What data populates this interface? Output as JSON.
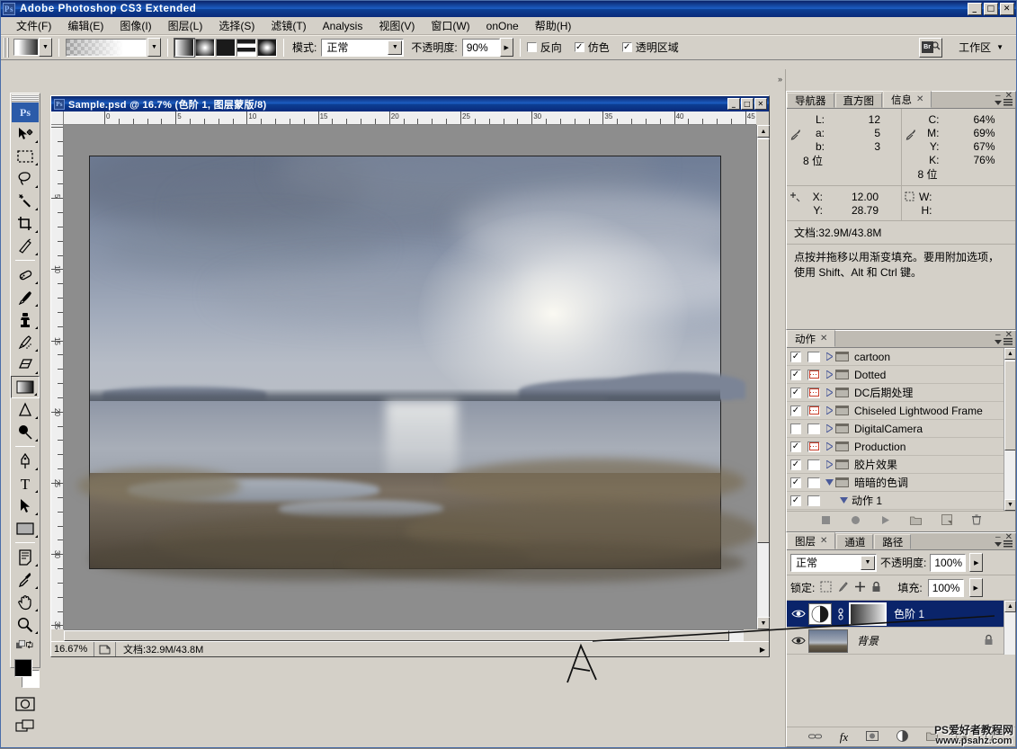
{
  "app": {
    "title": "Adobe Photoshop CS3 Extended",
    "logo": "Ps",
    "win_min": "_",
    "win_max": "□",
    "win_close": "✕"
  },
  "menubar": {
    "items": [
      {
        "label": "文件(F)"
      },
      {
        "label": "编辑(E)"
      },
      {
        "label": "图像(I)"
      },
      {
        "label": "图层(L)"
      },
      {
        "label": "选择(S)"
      },
      {
        "label": "滤镜(T)"
      },
      {
        "label": "Analysis"
      },
      {
        "label": "视图(V)"
      },
      {
        "label": "窗口(W)"
      },
      {
        "label": "onOne"
      },
      {
        "label": "帮助(H)"
      }
    ]
  },
  "options": {
    "mode_label": "模式:",
    "mode_value": "正常",
    "opacity_label": "不透明度:",
    "opacity_value": "90%",
    "reverse_label": "反向",
    "reverse_checked": false,
    "dither_label": "仿色",
    "dither_checked": true,
    "transparency_label": "透明区域",
    "transparency_checked": true,
    "bridge_badge": "Br",
    "workspace_label": "工作区",
    "gradient_types": [
      "linear-gradient-icon",
      "radial-gradient-icon",
      "angle-gradient-icon",
      "reflected-gradient-icon",
      "diamond-gradient-icon"
    ],
    "selected_gradient_type": 0
  },
  "toolbox": {
    "logo": "Ps",
    "tools": [
      {
        "name": "move-tool",
        "selected": false
      },
      {
        "name": "marquee-tool",
        "selected": false
      },
      {
        "name": "lasso-tool",
        "selected": false
      },
      {
        "name": "magic-wand-tool",
        "selected": false
      },
      {
        "name": "crop-tool",
        "selected": false
      },
      {
        "name": "slice-tool",
        "selected": false
      },
      {
        "name": "healing-brush-tool",
        "selected": false
      },
      {
        "name": "brush-tool",
        "selected": false
      },
      {
        "name": "clone-stamp-tool",
        "selected": false
      },
      {
        "name": "history-brush-tool",
        "selected": false
      },
      {
        "name": "eraser-tool",
        "selected": false
      },
      {
        "name": "gradient-tool",
        "selected": true
      },
      {
        "name": "blur-tool",
        "selected": false
      },
      {
        "name": "dodge-tool",
        "selected": false
      },
      {
        "name": "pen-tool",
        "selected": false
      },
      {
        "name": "type-tool",
        "selected": false
      },
      {
        "name": "path-selection-tool",
        "selected": false
      },
      {
        "name": "rectangle-tool",
        "selected": false
      },
      {
        "name": "notes-tool",
        "selected": false
      },
      {
        "name": "eyedropper-tool",
        "selected": false
      },
      {
        "name": "hand-tool",
        "selected": false
      },
      {
        "name": "zoom-tool",
        "selected": false
      }
    ],
    "foreground_color": "#000000",
    "background_color": "#ffffff"
  },
  "document": {
    "title": "Sample.psd @ 16.7% (色阶 1, 图层蒙版/8)",
    "logo": "Ps",
    "min": "_",
    "max": "□",
    "close": "✕",
    "zoom": "16.67%",
    "doc_size": "文档:32.9M/43.8M",
    "ruler_h_labels": [
      "0",
      "5",
      "10",
      "15",
      "20",
      "25",
      "30",
      "35",
      "40",
      "45"
    ],
    "ruler_v_labels": [
      "5",
      "10",
      "15",
      "20",
      "25",
      "30",
      "35"
    ]
  },
  "info_panel": {
    "tabs": [
      {
        "label": "导航器",
        "active": false
      },
      {
        "label": "直方图",
        "active": false
      },
      {
        "label": "信息",
        "active": true,
        "closable": true
      }
    ],
    "lab": [
      {
        "key": "L:",
        "value": "12"
      },
      {
        "key": "a:",
        "value": "5"
      },
      {
        "key": "b:",
        "value": "3"
      }
    ],
    "lab_bits": "8 位",
    "cmyk": [
      {
        "key": "C:",
        "value": "64%"
      },
      {
        "key": "M:",
        "value": "69%"
      },
      {
        "key": "Y:",
        "value": "67%"
      },
      {
        "key": "K:",
        "value": "76%"
      }
    ],
    "cmyk_bits": "8 位",
    "coords": [
      {
        "key": "X:",
        "value": "12.00"
      },
      {
        "key": "Y:",
        "value": "28.79"
      }
    ],
    "dims": [
      {
        "key": "W:",
        "value": ""
      },
      {
        "key": "H:",
        "value": ""
      }
    ],
    "doc_line": "文档:32.9M/43.8M",
    "hint_line1": "点按并拖移以用渐变填充。要用附加选项，",
    "hint_line2": "使用 Shift、Alt 和 Ctrl 键。"
  },
  "actions_panel": {
    "tabs": [
      {
        "label": "动作",
        "active": true,
        "closable": true
      }
    ],
    "rows": [
      {
        "checked": true,
        "modal": false,
        "expandable": true,
        "expanded": false,
        "folder": true,
        "label": "cartoon",
        "indent": 0
      },
      {
        "checked": true,
        "modal": true,
        "expandable": true,
        "expanded": false,
        "folder": true,
        "label": "Dotted",
        "indent": 0
      },
      {
        "checked": true,
        "modal": true,
        "expandable": true,
        "expanded": false,
        "folder": true,
        "label": "DC后期处理",
        "indent": 0
      },
      {
        "checked": true,
        "modal": true,
        "expandable": true,
        "expanded": false,
        "folder": true,
        "label": "Chiseled Lightwood Frame",
        "indent": 0
      },
      {
        "checked": false,
        "modal": false,
        "expandable": true,
        "expanded": false,
        "folder": true,
        "label": "DigitalCamera",
        "indent": 0
      },
      {
        "checked": true,
        "modal": true,
        "expandable": true,
        "expanded": false,
        "folder": true,
        "label": "Production",
        "indent": 0
      },
      {
        "checked": true,
        "modal": false,
        "expandable": true,
        "expanded": false,
        "folder": true,
        "label": "胶片效果",
        "indent": 0
      },
      {
        "checked": true,
        "modal": false,
        "expandable": true,
        "expanded": true,
        "folder": true,
        "label": "暗暗的色调",
        "indent": 0
      },
      {
        "checked": true,
        "modal": false,
        "expandable": true,
        "expanded": true,
        "folder": false,
        "label": "动作 1",
        "indent": 1
      }
    ],
    "footer_buttons": [
      "stop-icon",
      "record-icon",
      "play-icon",
      "new-set-icon",
      "new-action-icon",
      "delete-icon"
    ]
  },
  "layers_panel": {
    "tabs": [
      {
        "label": "图层",
        "active": true,
        "closable": true
      },
      {
        "label": "通道",
        "active": false
      },
      {
        "label": "路径",
        "active": false
      }
    ],
    "blend_mode": "正常",
    "opacity_label": "不透明度:",
    "opacity_value": "100%",
    "lock_label": "锁定:",
    "fill_label": "填充:",
    "fill_value": "100%",
    "lock_icons": [
      "lock-transparent-icon",
      "lock-paint-icon",
      "lock-position-icon",
      "lock-all-icon"
    ],
    "layers": [
      {
        "name": "色阶 1",
        "selected": true,
        "visible": true,
        "kind": "adjustment",
        "has_mask": true,
        "locked": false
      },
      {
        "name": "背景",
        "selected": false,
        "visible": true,
        "kind": "image",
        "has_mask": false,
        "locked": true
      }
    ],
    "footer_buttons": [
      "link-icon",
      "fx-icon",
      "mask-icon",
      "adjustment-icon",
      "group-icon",
      "new-layer-icon",
      "delete-layer-icon"
    ],
    "fx_label": "fx"
  },
  "watermark": {
    "line1": "PS爱好者教程网",
    "line2": "www.psahz.com"
  },
  "annotation": {
    "letter": "A"
  },
  "colors": {
    "titlebar_blue": "#0a246a",
    "panel_gray": "#d4d0c8",
    "selection_blue": "#0a246a",
    "canvas_gray": "#8d8d8d"
  }
}
